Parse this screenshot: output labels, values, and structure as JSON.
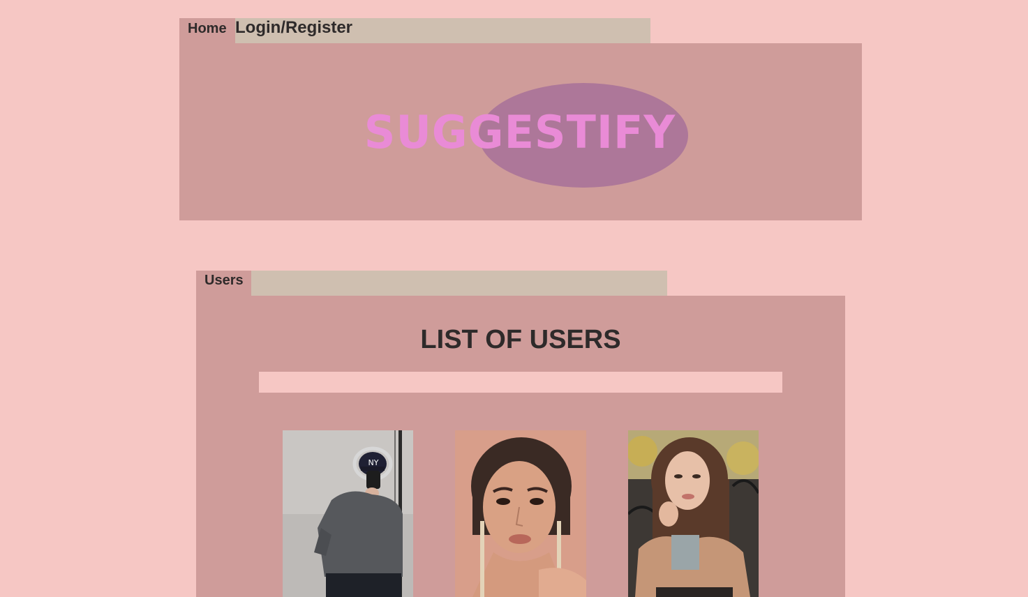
{
  "nav": {
    "home_label": "Home",
    "login_label": "Login/Register"
  },
  "header": {
    "logo_text": "SUGGESTIFY"
  },
  "users_section": {
    "tab_label": "Users",
    "title": "LIST OF USERS",
    "search_value": "",
    "search_placeholder": ""
  },
  "users": [
    {
      "photo": "man-in-cap-mirror-selfie"
    },
    {
      "photo": "woman-portrait-earrings"
    },
    {
      "photo": "woman-long-hair-balcony"
    }
  ],
  "colors": {
    "page_bg": "#f6c7c4",
    "panel_bg": "#cf9c9a",
    "tab_filler_bg": "#cfbfb0",
    "logo_ellipse": "#ad7799",
    "logo_text": "#e98bd6",
    "text_dark": "#2e2a2a"
  }
}
